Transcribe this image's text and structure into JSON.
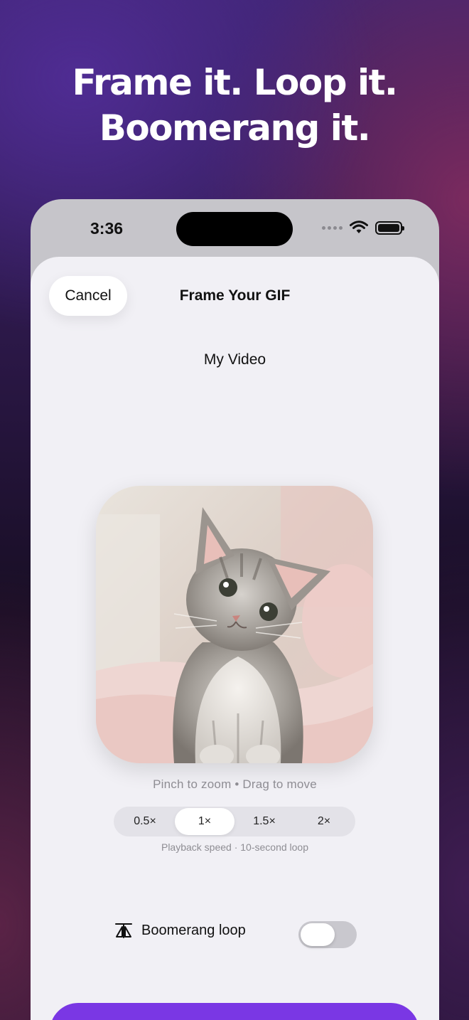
{
  "headline": {
    "line1": "Frame it. Loop it.",
    "line2": "Boomerang it."
  },
  "status_bar": {
    "time": "3:36"
  },
  "nav": {
    "cancel_label": "Cancel",
    "title": "Frame Your GIF"
  },
  "video": {
    "name": "My Video"
  },
  "hint": {
    "text": "Pinch to zoom  •  Drag to move"
  },
  "speed": {
    "options": [
      "0.5×",
      "1×",
      "1.5×",
      "2×"
    ],
    "selected": "1×",
    "caption": "Playback speed · 10-second loop"
  },
  "boomerang": {
    "label": "Boomerang loop",
    "enabled": false,
    "icon": "boomerang-icon"
  },
  "colors": {
    "accent": "#7a37e4",
    "sheet": "#f1f0f5"
  }
}
